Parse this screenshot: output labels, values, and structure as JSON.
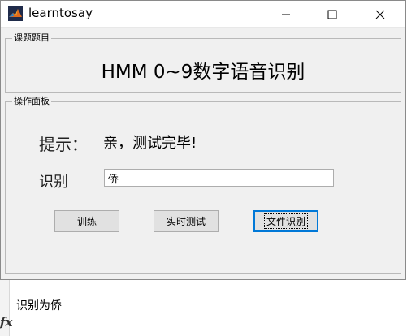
{
  "window": {
    "title": "learntosay",
    "controls": {
      "minimize_icon": "minimize-icon",
      "maximize_icon": "maximize-icon",
      "close_icon": "close-icon"
    }
  },
  "panel_title": {
    "group_label": "课题题目",
    "heading": "HMM 0~9数字语音识别"
  },
  "operations": {
    "group_label": "操作面板",
    "hint_label": "提示：",
    "hint_value": "亲，测试完毕!",
    "result_label": "识别",
    "result_value": "侨",
    "buttons": {
      "train": "训练",
      "realtime_test": "实时测试",
      "file_recognize": "文件识别"
    }
  },
  "console": {
    "prompt_icon": "fx",
    "output": "识别为侨"
  },
  "colors": {
    "window_bg": "#f0f0f0",
    "button_bg": "#e1e1e1",
    "focus_border": "#0078d7"
  }
}
